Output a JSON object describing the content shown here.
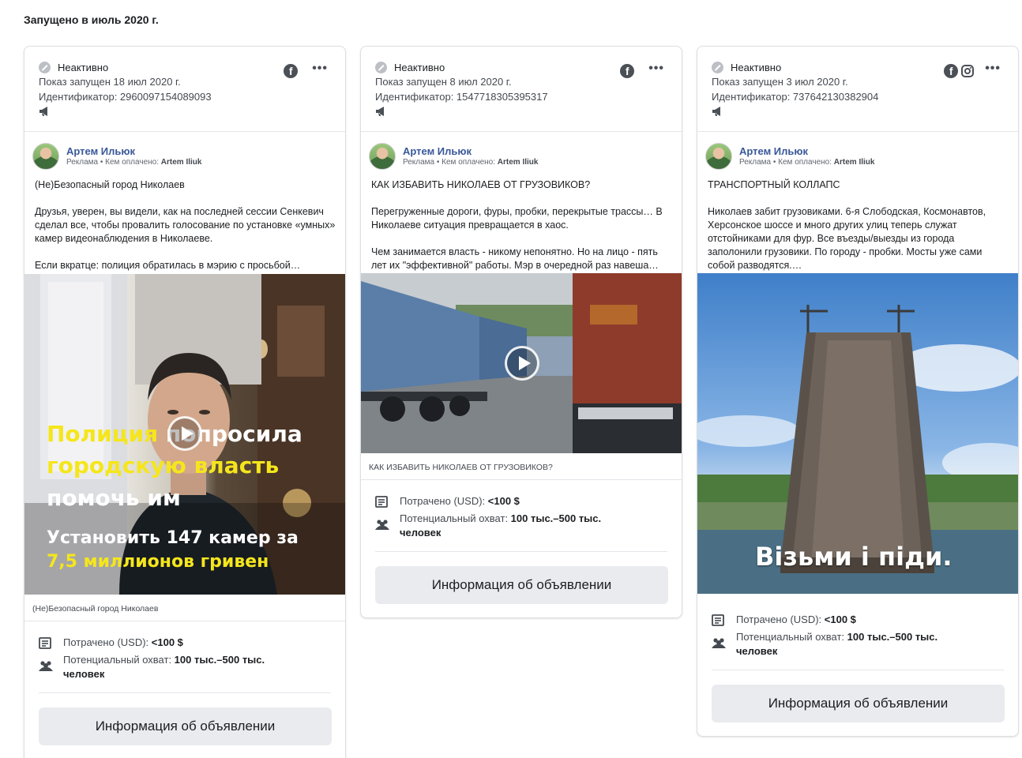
{
  "section_title": "Запущено в июль 2020 г.",
  "cards": [
    {
      "status": "Неактивно",
      "launched": "Показ запущен 18 июл 2020 г.",
      "ad_id": "Идентификатор: 2960097154089093",
      "platforms": [
        "facebook-icon"
      ],
      "advertiser": "Артем Ильюк",
      "sponsored_prefix": "Реклама • Кем оплачено:",
      "paid_by": "Artem Iliuk",
      "title": "(Не)Безопасный город Николаев",
      "paragraphs": [
        "Друзья, уверен, вы видели, как на последней сессии Сенкевич сделал все, чтобы провалить голосование по установке «умных» камер видеонаблюдения в Николаеве.",
        "Если вкратце: полиция обратилась в мэрию с просьбой…"
      ],
      "media_overlay": {
        "line1_yellow": "Полиция ",
        "line1_white": "попросила",
        "line2": "городскую власть",
        "line3": "помочь им",
        "line4": "Установить 147 камер за",
        "line5": "7,5 миллионов гривен"
      },
      "caption": "(Не)Безопасный город Николаев",
      "spent_label": "Потрачено (USD): ",
      "spent_value": "<100 $",
      "reach_label": "Потенциальный охват: ",
      "reach_value": "100 тыс.–500 тыс. человек",
      "button": "Информация об объявлении"
    },
    {
      "status": "Неактивно",
      "launched": "Показ запущен 8 июл 2020 г.",
      "ad_id": "Идентификатор: 1547718305395317",
      "platforms": [
        "facebook-icon"
      ],
      "advertiser": "Артем Ильюк",
      "sponsored_prefix": "Реклама • Кем оплачено:",
      "paid_by": "Artem Iliuk",
      "title": "КАК ИЗБАВИТЬ НИКОЛАЕВ ОТ ГРУЗОВИКОВ?",
      "paragraphs": [
        "Перегруженные дороги, фуры, пробки, перекрытые трассы… В Николаеве ситуация превращается в хаос.",
        "Чем занимается власть - никому непонятно. Но на лицо - пять лет их \"эффективной\" работы. Мэр в очередной раз навеша…"
      ],
      "caption": "КАК ИЗБАВИТЬ НИКОЛАЕВ ОТ ГРУЗОВИКОВ?",
      "spent_label": "Потрачено (USD): ",
      "spent_value": "<100 $",
      "reach_label": "Потенциальный охват: ",
      "reach_value": "100 тыс.–500 тыс. человек",
      "button": "Информация об объявлении"
    },
    {
      "status": "Неактивно",
      "launched": "Показ запущен 3 июл 2020 г.",
      "ad_id": "Идентификатор: 737642130382904",
      "platforms": [
        "facebook-icon",
        "instagram-icon"
      ],
      "advertiser": "Артем Ильюк",
      "sponsored_prefix": "Реклама • Кем оплачено:",
      "paid_by": "Artem Iliuk",
      "title": "ТРАНСПОРТНЫЙ КОЛЛАПС",
      "paragraphs": [
        "Николаев забит грузовиками. 6-я Слободская, Космонавтов, Херсонское шоссе и много других улиц теперь служат отстойниками для фур. Все въезды/выезды из города заполонили грузовики. По городу - пробки. Мосты уже сами собой разводятся.…"
      ],
      "media_overlay": {
        "line1": "Візьми і піди."
      },
      "spent_label": "Потрачено (USD): ",
      "spent_value": "<100 $",
      "reach_label": "Потенциальный охват: ",
      "reach_value": "100 тыс.–500 тыс. человек",
      "button": "Информация об объявлении"
    }
  ]
}
